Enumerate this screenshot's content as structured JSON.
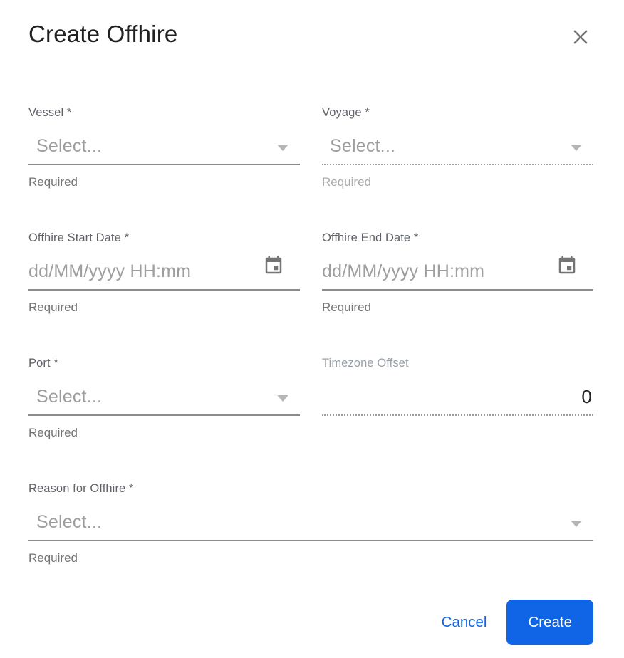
{
  "dialog": {
    "title": "Create Offhire"
  },
  "icons": {
    "close": "close-icon",
    "chevron": "chevron-down-icon",
    "calendar": "calendar-icon"
  },
  "fields": {
    "vessel": {
      "label": "Vessel *",
      "placeholder": "Select...",
      "helper": "Required"
    },
    "voyage": {
      "label": "Voyage *",
      "placeholder": "Select...",
      "helper": "Required"
    },
    "start": {
      "label": "Offhire Start Date *",
      "placeholder": "dd/MM/yyyy HH:mm",
      "helper": "Required"
    },
    "end": {
      "label": "Offhire End Date *",
      "placeholder": "dd/MM/yyyy HH:mm",
      "helper": "Required"
    },
    "port": {
      "label": "Port *",
      "placeholder": "Select...",
      "helper": "Required"
    },
    "timezone": {
      "label": "Timezone Offset",
      "value": "0"
    },
    "reason": {
      "label": "Reason for Offhire *",
      "placeholder": "Select...",
      "helper": "Required"
    }
  },
  "actions": {
    "cancel": "Cancel",
    "create": "Create"
  },
  "colors": {
    "primary": "#1065e6",
    "underline": "#8c8c8c",
    "underline_disabled": "#9e9e9e",
    "title": "#212121",
    "label": "#5f6368",
    "placeholder": "#9e9e9e",
    "helper": "#757575",
    "icon": "#757575"
  }
}
